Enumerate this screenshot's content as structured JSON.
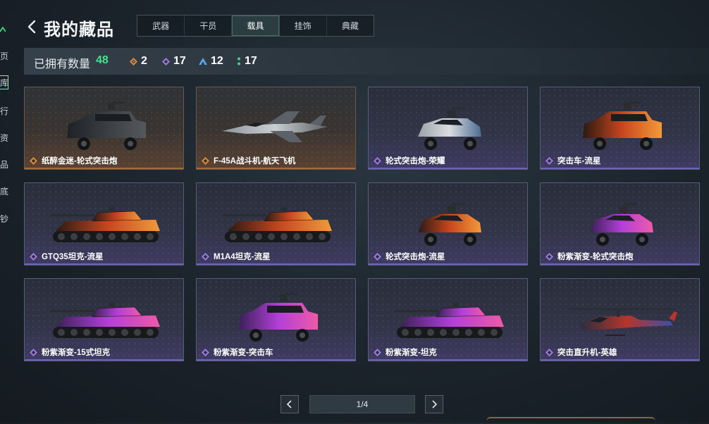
{
  "header": {
    "title": "我的藏品",
    "back_icon": "chevron-left-icon"
  },
  "tabs": [
    {
      "label": "武器",
      "active": false
    },
    {
      "label": "干员",
      "active": false
    },
    {
      "label": "载具",
      "active": true
    },
    {
      "label": "挂饰",
      "active": false
    },
    {
      "label": "典藏",
      "active": false
    }
  ],
  "summary": {
    "label": "已拥有数量",
    "total": "48",
    "rarities": [
      {
        "icon": "orange-diamond-icon",
        "color": "#e08a3c",
        "count": "2"
      },
      {
        "icon": "purple-diamond-icon",
        "color": "#9b7be0",
        "count": "17"
      },
      {
        "icon": "blue-triangle-icon",
        "color": "#5aa6e6",
        "count": "12"
      },
      {
        "icon": "green-dots-icon",
        "color": "#3ed68a",
        "count": "17"
      }
    ]
  },
  "vehicles": [
    {
      "name": "纸醉金迷-轮式突击炮",
      "rarity": "gold",
      "kind": "armored-car",
      "skin": "black"
    },
    {
      "name": "F-45A战斗机-航天飞机",
      "rarity": "gold",
      "kind": "jet",
      "skin": "silver"
    },
    {
      "name": "轮式突击炮-荣耀",
      "rarity": "purple",
      "kind": "buggy",
      "skin": "white"
    },
    {
      "name": "突击车-流星",
      "rarity": "purple",
      "kind": "armored-car",
      "skin": "lava"
    },
    {
      "name": "GTQ35坦克-流星",
      "rarity": "purple",
      "kind": "tank",
      "skin": "lava"
    },
    {
      "name": "M1A4坦克-流星",
      "rarity": "purple",
      "kind": "tank",
      "skin": "lava"
    },
    {
      "name": "轮式突击炮-流星",
      "rarity": "purple",
      "kind": "buggy",
      "skin": "lava"
    },
    {
      "name": "粉紫渐变-轮式突击炮",
      "rarity": "purple",
      "kind": "buggy",
      "skin": "pink"
    },
    {
      "name": "粉紫渐变-15式坦克",
      "rarity": "purple",
      "kind": "tank",
      "skin": "pink"
    },
    {
      "name": "粉紫渐变-突击车",
      "rarity": "purple",
      "kind": "armored-car",
      "skin": "pink"
    },
    {
      "name": "粉紫渐变-坦克",
      "rarity": "purple",
      "kind": "tank",
      "skin": "pink"
    },
    {
      "name": "突击直升机-英雄",
      "rarity": "purple",
      "kind": "helicopter",
      "skin": "hero"
    }
  ],
  "pagination": {
    "text": "1/4"
  },
  "colors": {
    "accent_green": "#3ee68a",
    "gold_rarity": "#e08a3c",
    "purple_rarity": "#9b7be0"
  }
}
